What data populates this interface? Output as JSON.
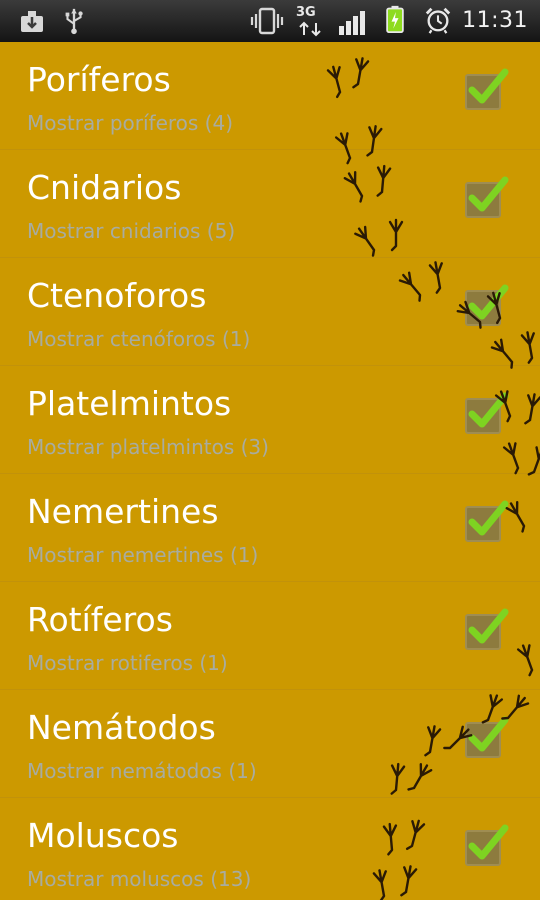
{
  "status_bar": {
    "time": "11:31",
    "network_label": "3G",
    "icons": [
      "download-notification-icon",
      "usb-icon",
      "vibrate-icon",
      "3g-data-icon",
      "signal-icon",
      "battery-charging-icon",
      "alarm-icon"
    ]
  },
  "preferences": [
    {
      "title": "Poríferos",
      "summary": "Mostrar poríferos (4)",
      "checked": true
    },
    {
      "title": "Cnidarios",
      "summary": "Mostrar cnidarios (5)",
      "checked": true
    },
    {
      "title": "Ctenoforos",
      "summary": "Mostrar ctenóforos (1)",
      "checked": true
    },
    {
      "title": "Platelmintos",
      "summary": "Mostrar platelmintos (3)",
      "checked": true
    },
    {
      "title": "Nemertines",
      "summary": "Mostrar nemertines (1)",
      "checked": true
    },
    {
      "title": "Rotíferos",
      "summary": "Mostrar rotiferos (1)",
      "checked": true
    },
    {
      "title": "Nemátodos",
      "summary": "Mostrar nemátodos (1)",
      "checked": true
    },
    {
      "title": "Moluscos",
      "summary": "Mostrar moluscos (13)",
      "checked": true
    }
  ],
  "colors": {
    "background": "#CC9900",
    "title_text": "#FFFFFF",
    "summary_text": "#A8ACA0",
    "check_green": "#7ED321",
    "status_bar": "#1A1A1A",
    "battery_green": "#8EDB1F"
  },
  "decoration": "bird-footprints-trail-icon"
}
